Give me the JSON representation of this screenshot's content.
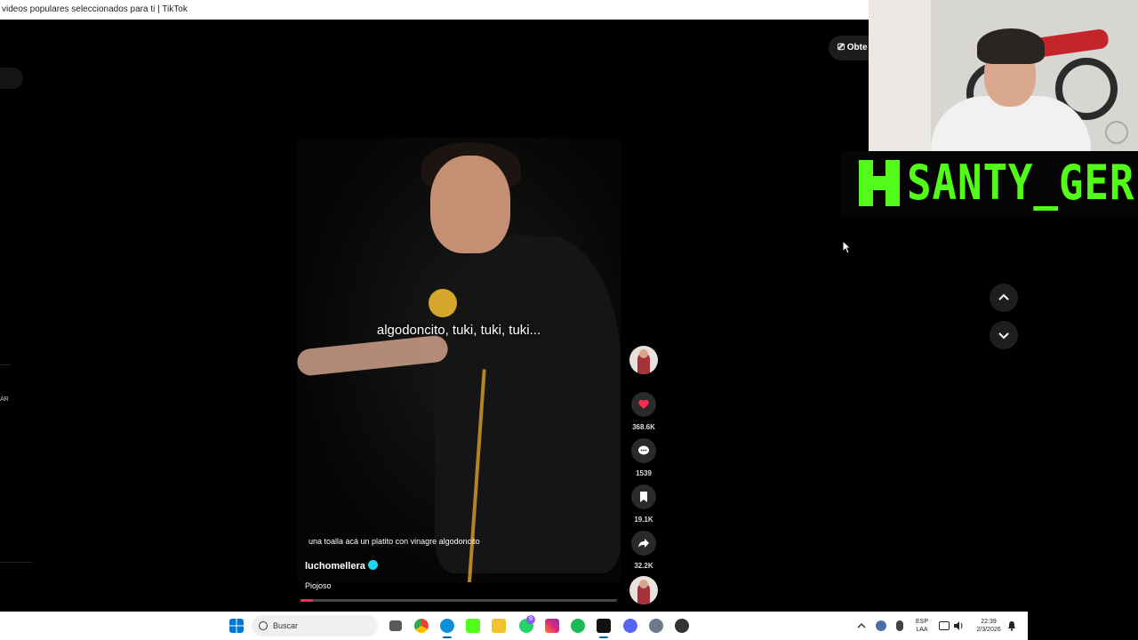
{
  "browser": {
    "tab_title": "videos populares seleccionados para ti | TikTok"
  },
  "page": {
    "get_app_label": "Obte",
    "left_badge": "AR"
  },
  "video": {
    "overlay_subtitle": "algodoncito, tuki, tuki, tuki...",
    "caption": "una toalla acá un platito con vinagre algodoncito",
    "username": "luchomellera",
    "sound": "Piojoso",
    "progress_percent": 4
  },
  "actions": {
    "likes": "368.6K",
    "comments": "1539",
    "saves": "19.1K",
    "shares": "32.2K"
  },
  "stream_overlay": {
    "channel_name": "SANTY_GER",
    "brand_color": "#53fc18"
  },
  "taskbar": {
    "search_label": "Buscar",
    "language_top": "ESP",
    "language_bottom": "LAA",
    "time": "22:39",
    "date": "2/3/2026",
    "whatsapp_badge": "9"
  }
}
